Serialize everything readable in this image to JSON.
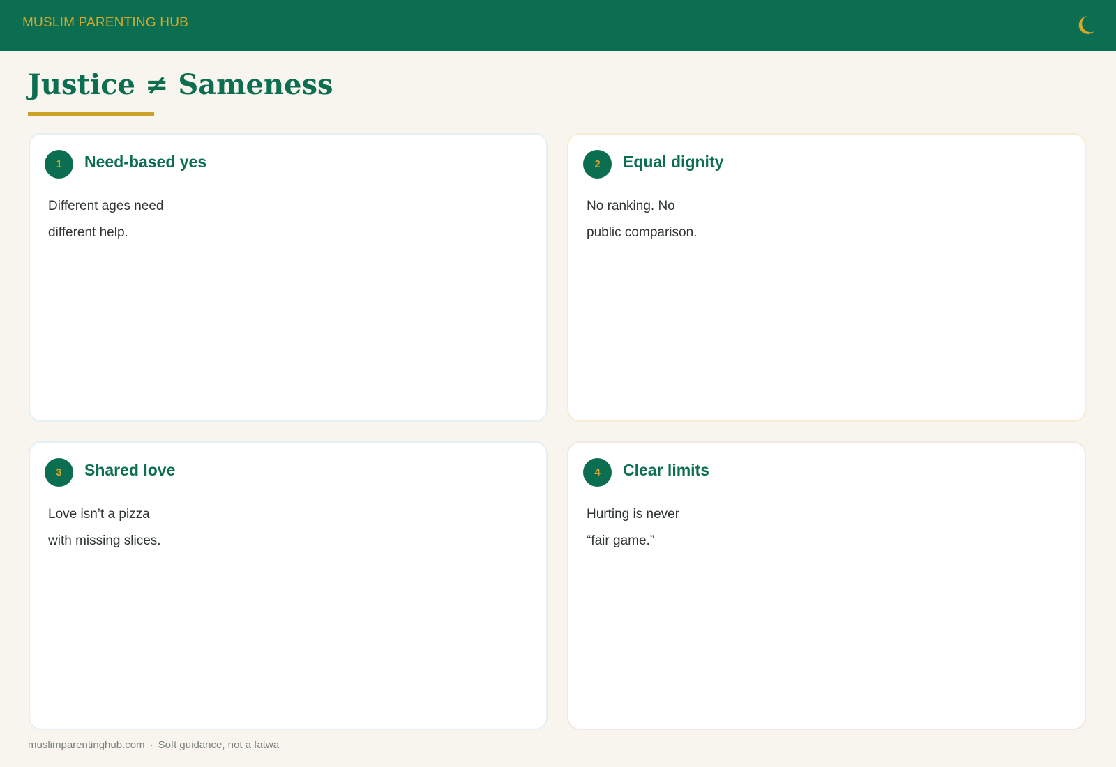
{
  "header": {
    "brand": "MUSLIM PARENTING HUB",
    "icon": "crescent-moon-icon",
    "background": "#0c6e51",
    "accent": "#d4a82c"
  },
  "page": {
    "title": "Justice ≠ Sameness"
  },
  "cards": [
    {
      "number": "1",
      "title": "Need-based yes",
      "lines": [
        "Different ages need",
        "different help."
      ]
    },
    {
      "number": "2",
      "title": "Equal dignity",
      "lines": [
        "No ranking. No",
        "public comparison."
      ]
    },
    {
      "number": "3",
      "title": "Shared love",
      "lines": [
        "Love isn’t a pizza",
        "with missing slices."
      ]
    },
    {
      "number": "4",
      "title": "Clear limits",
      "lines": [
        "Hurting is never",
        "“fair game.”"
      ]
    }
  ],
  "footer": {
    "site": "muslimparentinghub.com",
    "separator": "·",
    "note": "Soft guidance, not a fatwa"
  }
}
